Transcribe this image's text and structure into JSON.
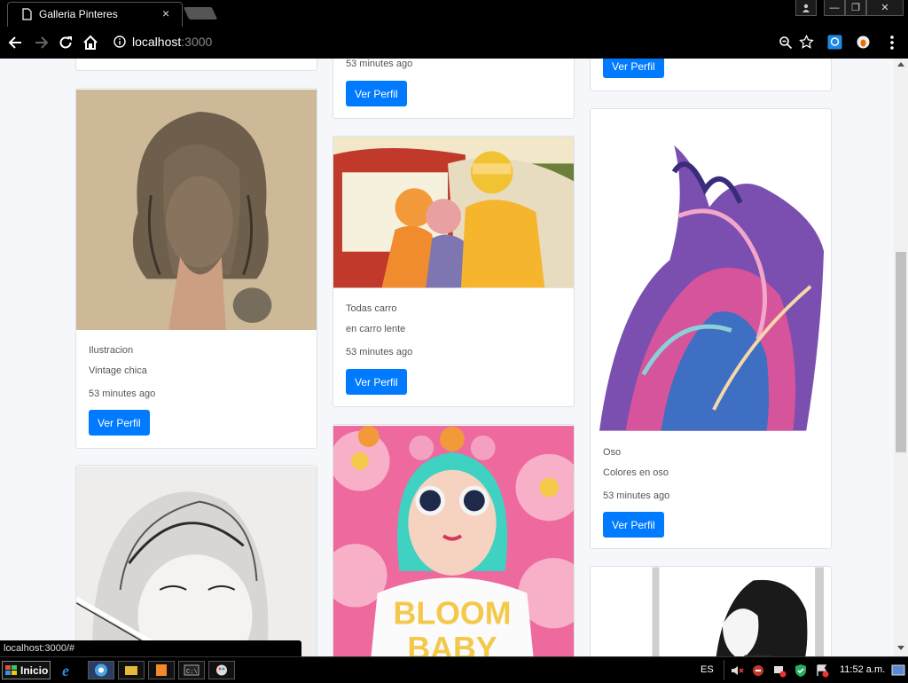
{
  "browser": {
    "tab_title": "Galleria Pinteres",
    "close_glyph": "×",
    "url_host": "localhost",
    "url_port": ":3000",
    "window_buttons": {
      "minimize": "—",
      "restore": "❐",
      "close": "✕"
    }
  },
  "gallery": {
    "button_label": "Ver Perfil",
    "cards": [
      {
        "id": "col2-top",
        "time": "53 minutes ago"
      },
      {
        "id": "vintage",
        "category": "Ilustracion",
        "title": "Vintage chica",
        "time": "53 minutes ago"
      },
      {
        "id": "carro",
        "category": "Todas carro",
        "title": "en carro lente",
        "time": "53 minutes ago"
      },
      {
        "id": "oso",
        "category": "Oso",
        "title": "Colores en oso",
        "time": "53 minutes ago"
      },
      {
        "id": "sketch"
      },
      {
        "id": "bloom",
        "shirt_text": [
          "BLOOM",
          "BABY"
        ]
      },
      {
        "id": "manga"
      }
    ]
  },
  "status_url": "localhost:3000/#",
  "taskbar": {
    "start_label": "Inicio",
    "language": "ES",
    "clock": "11:52 a.m."
  },
  "colors": {
    "primary": "#007bff",
    "page_bg": "#f5f7fa",
    "chrome_bg": "#000000"
  },
  "icons": [
    "page-icon",
    "back-icon",
    "forward-icon",
    "reload-icon",
    "home-icon",
    "info-icon",
    "zoom-icon",
    "star-icon",
    "extension-icon",
    "profile-icon",
    "menu-icon",
    "windows-flag-icon"
  ]
}
